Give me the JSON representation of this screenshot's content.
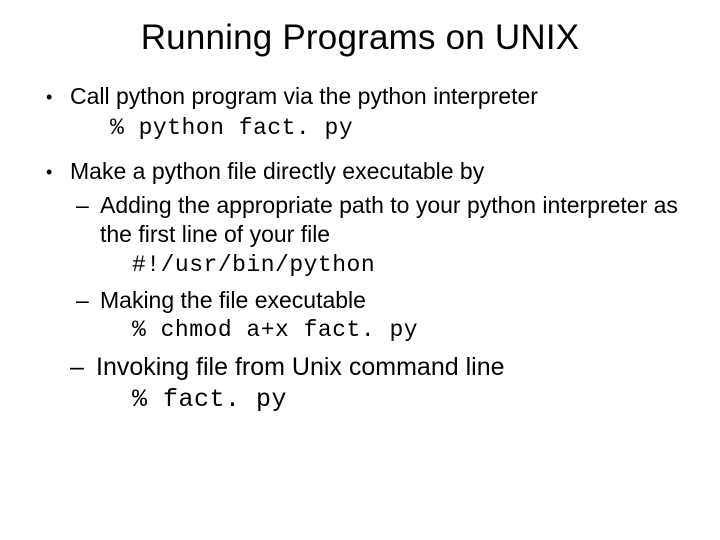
{
  "title": "Running Programs on UNIX",
  "bullets": [
    {
      "text": "Call python program via the python interpreter",
      "code": "% python fact. py"
    },
    {
      "text": "Make a python file directly executable by",
      "subs": [
        {
          "text": "Adding the appropriate path to your python interpreter as the first line of your file",
          "code": "#!/usr/bin/python"
        },
        {
          "text": "Making the file executable",
          "code": "% chmod a+x fact. py"
        },
        {
          "big": true,
          "text": "Invoking file from Unix command line",
          "code": "% fact. py"
        }
      ]
    }
  ]
}
